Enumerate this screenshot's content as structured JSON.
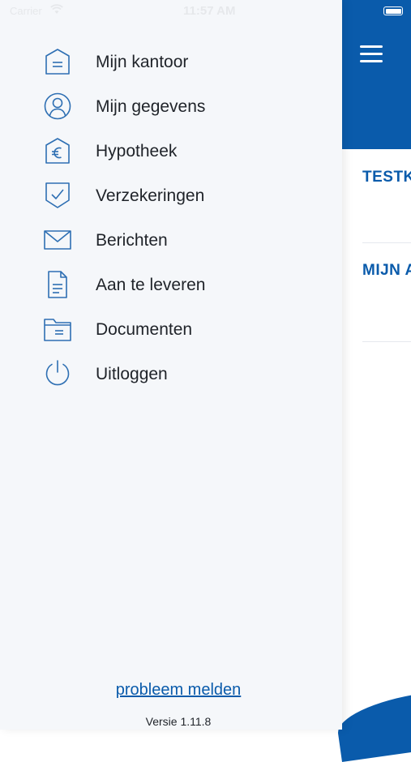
{
  "status_bar": {
    "carrier": "Carrier",
    "time": "11:57 AM"
  },
  "menu": {
    "items": [
      {
        "label": "Mijn kantoor",
        "icon": "office-doc-icon"
      },
      {
        "label": "Mijn gegevens",
        "icon": "user-circle-icon"
      },
      {
        "label": "Hypotheek",
        "icon": "euro-house-icon"
      },
      {
        "label": "Verzekeringen",
        "icon": "shield-check-icon"
      },
      {
        "label": "Berichten",
        "icon": "envelope-icon"
      },
      {
        "label": "Aan te leveren",
        "icon": "document-icon"
      },
      {
        "label": "Documenten",
        "icon": "folder-icon"
      },
      {
        "label": "Uitloggen",
        "icon": "power-icon"
      }
    ]
  },
  "footer": {
    "report_link": "probleem melden",
    "version": "Versie 1.11.8"
  },
  "app": {
    "rows": [
      "TESTK",
      "MIJN A"
    ]
  },
  "colors": {
    "brand": "#0a5bab",
    "drawer_bg": "#f5f7fa",
    "icon": "#2e6fb3"
  }
}
